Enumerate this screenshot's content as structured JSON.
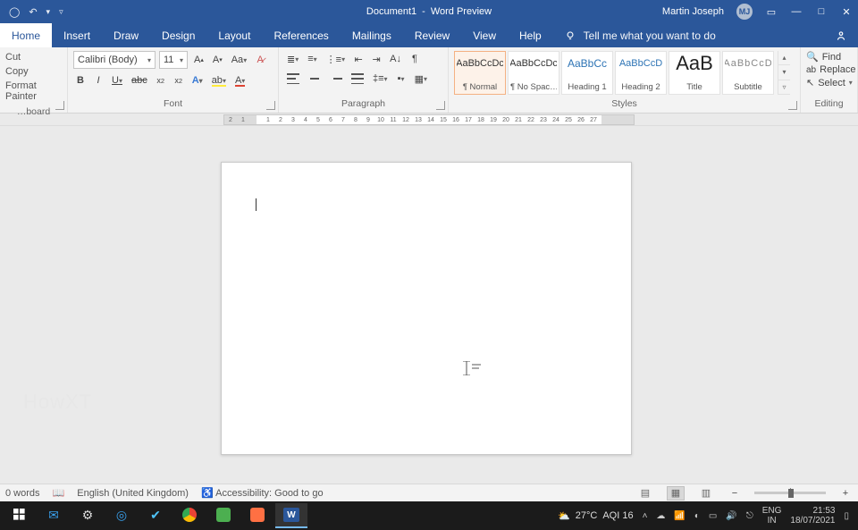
{
  "titlebar": {
    "doc": "Document1",
    "app": "Word Preview",
    "user": "Martin Joseph",
    "initials": "MJ"
  },
  "tabs": [
    "Home",
    "Insert",
    "Draw",
    "Design",
    "Layout",
    "References",
    "Mailings",
    "Review",
    "View",
    "Help"
  ],
  "tellme": "Tell me what you want to do",
  "clipboard": {
    "cut": "Cut",
    "copy": "Copy",
    "painter": "Format Painter",
    "label": "…board"
  },
  "font": {
    "name": "Calibri (Body)",
    "size": "11",
    "label": "Font"
  },
  "paragraph": {
    "label": "Paragraph"
  },
  "styles": {
    "label": "Styles",
    "gallery": [
      {
        "preview": "AaBbCcDc",
        "name": "¶ Normal",
        "cls": "",
        "sel": true
      },
      {
        "preview": "AaBbCcDc",
        "name": "¶ No Spac…",
        "cls": ""
      },
      {
        "preview": "AaBbCc",
        "name": "Heading 1",
        "cls": "h1"
      },
      {
        "preview": "AaBbCcD",
        "name": "Heading 2",
        "cls": "h2"
      },
      {
        "preview": "AaB",
        "name": "Title",
        "cls": "title"
      },
      {
        "preview": "AaBbCcD",
        "name": "Subtitle",
        "cls": "sub"
      }
    ]
  },
  "editing": {
    "find": "Find",
    "replace": "Replace",
    "select": "Select",
    "label": "Editing"
  },
  "watermark": "HowXT",
  "status": {
    "words": "0 words",
    "lang": "English (United Kingdom)",
    "a11y": "Accessibility: Good to go"
  },
  "taskbar": {
    "weather_temp": "27°C",
    "weather_aqi": "AQI 16",
    "lang1": "ENG",
    "lang2": "IN",
    "time": "21:53",
    "date": "18/07/2021"
  }
}
